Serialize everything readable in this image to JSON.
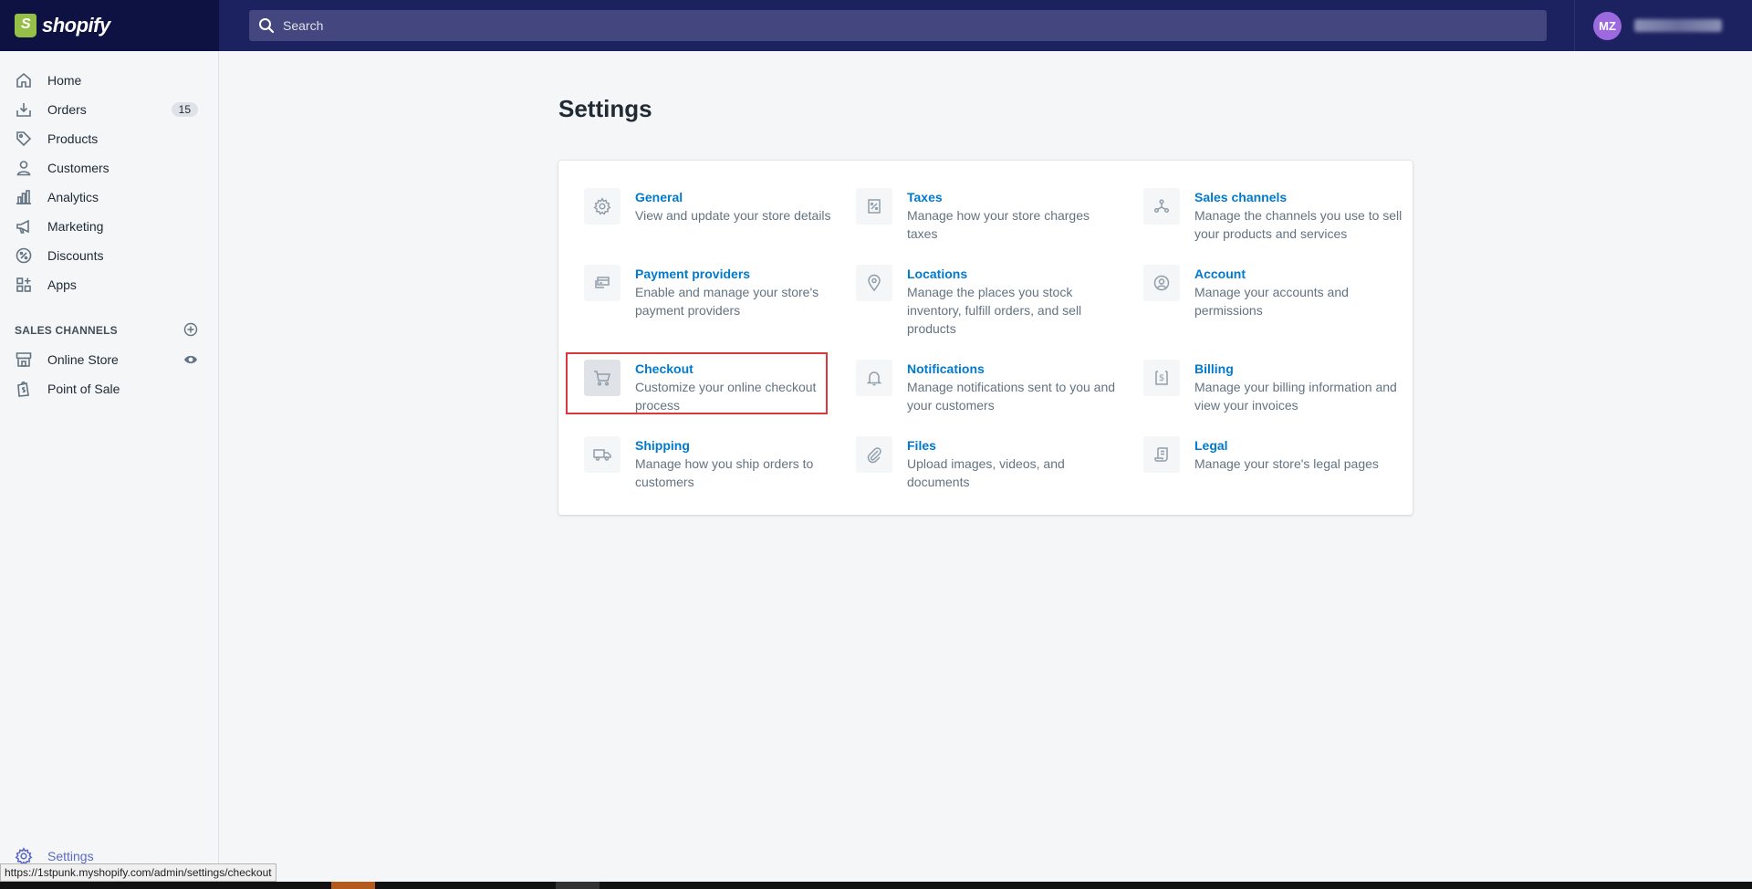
{
  "topbar": {
    "logo_text": "shopify",
    "search_placeholder": "Search",
    "user_initials": "MZ"
  },
  "sidebar": {
    "items": [
      {
        "label": "Home",
        "icon": "home-icon"
      },
      {
        "label": "Orders",
        "icon": "orders-icon",
        "badge": "15"
      },
      {
        "label": "Products",
        "icon": "tag-icon"
      },
      {
        "label": "Customers",
        "icon": "person-icon"
      },
      {
        "label": "Analytics",
        "icon": "bar-chart-icon"
      },
      {
        "label": "Marketing",
        "icon": "megaphone-icon"
      },
      {
        "label": "Discounts",
        "icon": "discount-icon"
      },
      {
        "label": "Apps",
        "icon": "apps-icon"
      }
    ],
    "sales_channels_heading": "SALES CHANNELS",
    "channels": [
      {
        "label": "Online Store",
        "icon": "store-icon"
      },
      {
        "label": "Point of Sale",
        "icon": "shopify-bag-icon"
      }
    ],
    "settings_label": "Settings"
  },
  "status_url": "https://1stpunk.myshopify.com/admin/settings/checkout",
  "main": {
    "title": "Settings",
    "settings": [
      {
        "name": "General",
        "desc": "View and update your store details",
        "icon": "gear-icon"
      },
      {
        "name": "Taxes",
        "desc": "Manage how your store charges taxes",
        "icon": "tax-icon"
      },
      {
        "name": "Sales channels",
        "desc": "Manage the channels you use to sell your products and services",
        "icon": "channels-icon"
      },
      {
        "name": "Payment providers",
        "desc": "Enable and manage your store's payment providers",
        "icon": "payment-icon"
      },
      {
        "name": "Locations",
        "desc": "Manage the places you stock inventory, fulfill orders, and sell products",
        "icon": "location-pin-icon"
      },
      {
        "name": "Account",
        "desc": "Manage your accounts and permissions",
        "icon": "account-icon"
      },
      {
        "name": "Checkout",
        "desc": "Customize your online checkout process",
        "icon": "cart-icon"
      },
      {
        "name": "Notifications",
        "desc": "Manage notifications sent to you and your customers",
        "icon": "bell-icon"
      },
      {
        "name": "Billing",
        "desc": "Manage your billing information and view your invoices",
        "icon": "billing-icon"
      },
      {
        "name": "Shipping",
        "desc": "Manage how you ship orders to customers",
        "icon": "truck-icon"
      },
      {
        "name": "Files",
        "desc": "Upload images, videos, and documents",
        "icon": "paperclip-icon"
      },
      {
        "name": "Legal",
        "desc": "Manage your store's legal pages",
        "icon": "legal-icon"
      }
    ]
  }
}
